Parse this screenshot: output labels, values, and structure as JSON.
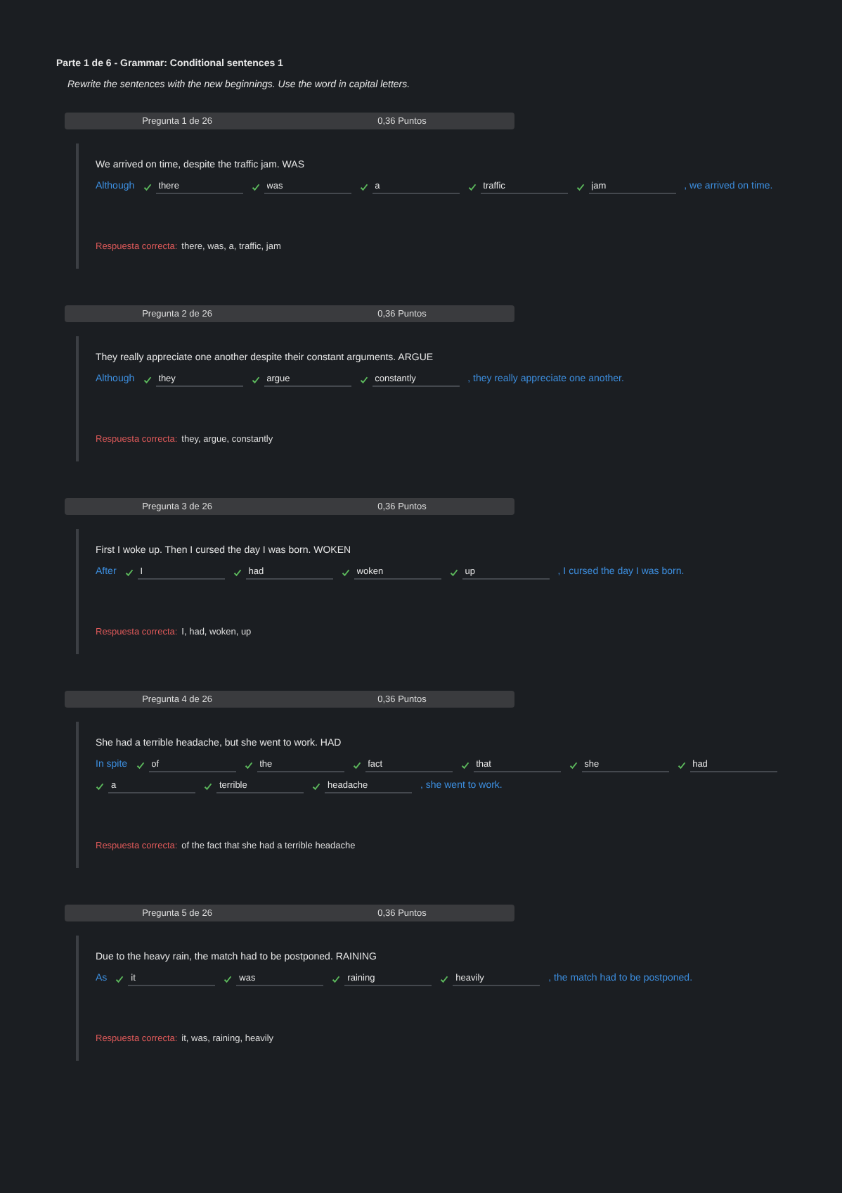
{
  "part_title": "Parte 1 de 6 - Grammar: Conditional sentences 1",
  "instructions": "Rewrite the sentences with the new beginnings. Use the word in capital letters.",
  "questions": [
    {
      "header": "Pregunta 1 de 26",
      "points": "0,36 Puntos",
      "prompt": "We arrived on time, despite the traffic jam. WAS",
      "prefix": "Although",
      "answers": [
        {
          "value": "there",
          "correct": true
        },
        {
          "value": "was",
          "correct": true
        },
        {
          "value": "a",
          "correct": true
        },
        {
          "value": "traffic",
          "correct": true
        },
        {
          "value": "jam",
          "correct": true
        }
      ],
      "suffix": ", we arrived on time.",
      "correct_label": "Respuesta correcta:",
      "correct_answer": "there, was, a, traffic, jam"
    },
    {
      "header": "Pregunta 2 de 26",
      "points": "0,36 Puntos",
      "prompt": "They really appreciate one another despite their constant arguments. ARGUE",
      "prefix": "Although",
      "answers": [
        {
          "value": "they",
          "correct": true
        },
        {
          "value": "argue",
          "correct": true
        },
        {
          "value": "constantly",
          "correct": true
        }
      ],
      "suffix": ", they really appreciate one another.",
      "correct_label": "Respuesta correcta:",
      "correct_answer": "they, argue, constantly"
    },
    {
      "header": "Pregunta 3 de 26",
      "points": "0,36 Puntos",
      "prompt": "First I woke up. Then I cursed the day I was born. WOKEN",
      "prefix": "After",
      "answers": [
        {
          "value": "I",
          "correct": true
        },
        {
          "value": "had",
          "correct": true
        },
        {
          "value": "woken",
          "correct": true
        },
        {
          "value": "up",
          "correct": true
        }
      ],
      "suffix": ", I cursed the day I was born.",
      "correct_label": "Respuesta correcta:",
      "correct_answer": "I, had, woken, up"
    },
    {
      "header": "Pregunta 4 de 26",
      "points": "0,36 Puntos",
      "prompt": "She had a terrible headache, but she went to work. HAD",
      "prefix": "In spite",
      "answers": [
        {
          "value": "of",
          "correct": true
        },
        {
          "value": "the",
          "correct": true
        },
        {
          "value": "fact",
          "correct": true
        },
        {
          "value": "that",
          "correct": true
        },
        {
          "value": "she",
          "correct": true
        },
        {
          "value": "had",
          "correct": true
        },
        {
          "value": "a",
          "correct": true
        },
        {
          "value": "terrible",
          "correct": true
        },
        {
          "value": "headache",
          "correct": true
        }
      ],
      "suffix": ", she went to work.",
      "correct_label": "Respuesta correcta:",
      "correct_answer": "of the fact that she had a terrible headache"
    },
    {
      "header": "Pregunta 5 de 26",
      "points": "0,36 Puntos",
      "prompt": "Due to the heavy rain, the match had to be postponed. RAINING",
      "prefix": "As",
      "answers": [
        {
          "value": "it",
          "correct": true
        },
        {
          "value": "was",
          "correct": true
        },
        {
          "value": "raining",
          "correct": true
        },
        {
          "value": "heavily",
          "correct": true
        }
      ],
      "suffix": ", the match had to be postponed.",
      "correct_label": "Respuesta correcta:",
      "correct_answer": "it, was, raining, heavily"
    }
  ]
}
